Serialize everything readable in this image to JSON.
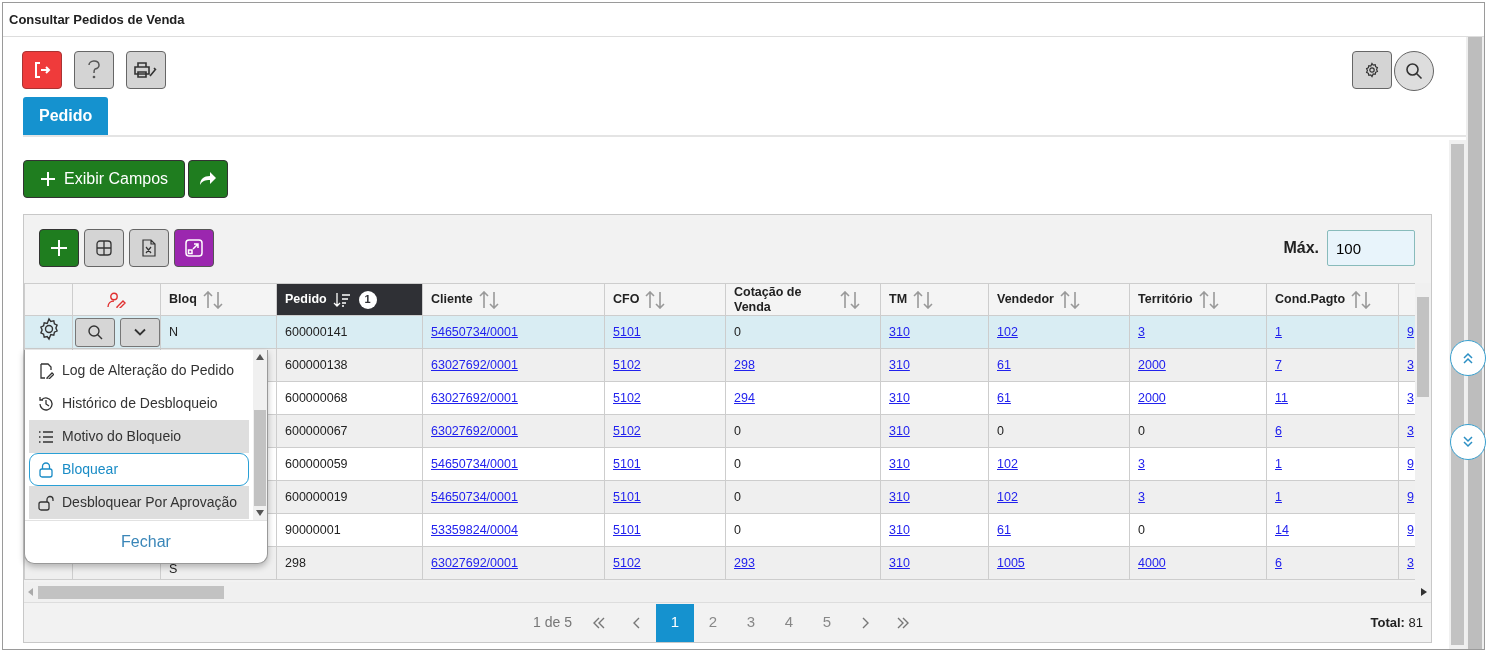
{
  "window": {
    "title": "Consultar Pedidos de Venda"
  },
  "tabs": [
    {
      "label": "Pedido",
      "selected": true
    }
  ],
  "show_fields_button": "Exibir Campos",
  "grid": {
    "max_label": "Máx.",
    "max_value": "100",
    "columns": [
      {
        "label": "Bloq",
        "sorted": false
      },
      {
        "label": "Pedido",
        "sorted": true,
        "sort_rank": "1"
      },
      {
        "label": "Cliente",
        "sorted": false
      },
      {
        "label": "CFO",
        "sorted": false
      },
      {
        "label": "Cotação de Venda",
        "sorted": false
      },
      {
        "label": "TM",
        "sorted": false
      },
      {
        "label": "Vendedor",
        "sorted": false
      },
      {
        "label": "Território",
        "sorted": false
      },
      {
        "label": "Cond.Pagto",
        "sorted": false
      }
    ],
    "rows": [
      {
        "selected": true,
        "cells": [
          {
            "text": "N",
            "link": false
          },
          {
            "text": "600000141",
            "link": false
          },
          {
            "text": "54650734/0001",
            "link": true
          },
          {
            "text": "5101",
            "link": true
          },
          {
            "text": "0",
            "link": false
          },
          {
            "text": "310",
            "link": true
          },
          {
            "text": "102",
            "link": true
          },
          {
            "text": "3",
            "link": true
          },
          {
            "text": "1",
            "link": true
          },
          {
            "text": "9",
            "link": true
          }
        ]
      },
      {
        "selected": false,
        "cells": [
          {
            "text": ""
          },
          {
            "text": "600000138",
            "link": false
          },
          {
            "text": "63027692/0001",
            "link": true
          },
          {
            "text": "5102",
            "link": true
          },
          {
            "text": "298",
            "link": true
          },
          {
            "text": "310",
            "link": true
          },
          {
            "text": "61",
            "link": true
          },
          {
            "text": "2000",
            "link": true
          },
          {
            "text": "7",
            "link": true
          },
          {
            "text": "3",
            "link": true
          }
        ]
      },
      {
        "selected": false,
        "cells": [
          {
            "text": ""
          },
          {
            "text": "600000068",
            "link": false
          },
          {
            "text": "63027692/0001",
            "link": true
          },
          {
            "text": "5102",
            "link": true
          },
          {
            "text": "294",
            "link": true
          },
          {
            "text": "310",
            "link": true
          },
          {
            "text": "61",
            "link": true
          },
          {
            "text": "2000",
            "link": true
          },
          {
            "text": "11",
            "link": true
          },
          {
            "text": "3",
            "link": true
          }
        ]
      },
      {
        "selected": false,
        "cells": [
          {
            "text": ""
          },
          {
            "text": "600000067",
            "link": false
          },
          {
            "text": "63027692/0001",
            "link": true
          },
          {
            "text": "5102",
            "link": true
          },
          {
            "text": "0",
            "link": false
          },
          {
            "text": "310",
            "link": true
          },
          {
            "text": "0",
            "link": false
          },
          {
            "text": "0",
            "link": false
          },
          {
            "text": "6",
            "link": true
          },
          {
            "text": "3",
            "link": true
          }
        ]
      },
      {
        "selected": false,
        "cells": [
          {
            "text": ""
          },
          {
            "text": "600000059",
            "link": false
          },
          {
            "text": "54650734/0001",
            "link": true
          },
          {
            "text": "5101",
            "link": true
          },
          {
            "text": "0",
            "link": false
          },
          {
            "text": "310",
            "link": true
          },
          {
            "text": "102",
            "link": true
          },
          {
            "text": "3",
            "link": true
          },
          {
            "text": "1",
            "link": true
          },
          {
            "text": "9",
            "link": true
          }
        ]
      },
      {
        "selected": false,
        "cells": [
          {
            "text": ""
          },
          {
            "text": "600000019",
            "link": false
          },
          {
            "text": "54650734/0001",
            "link": true
          },
          {
            "text": "5101",
            "link": true
          },
          {
            "text": "0",
            "link": false
          },
          {
            "text": "310",
            "link": true
          },
          {
            "text": "102",
            "link": true
          },
          {
            "text": "3",
            "link": true
          },
          {
            "text": "1",
            "link": true
          },
          {
            "text": "9",
            "link": true
          }
        ]
      },
      {
        "selected": false,
        "cells": [
          {
            "text": ""
          },
          {
            "text": "90000001",
            "link": false
          },
          {
            "text": "53359824/0004",
            "link": true
          },
          {
            "text": "5101",
            "link": true
          },
          {
            "text": "0",
            "link": false
          },
          {
            "text": "310",
            "link": true
          },
          {
            "text": "61",
            "link": true
          },
          {
            "text": "0",
            "link": false
          },
          {
            "text": "14",
            "link": true
          },
          {
            "text": "9",
            "link": true
          }
        ]
      },
      {
        "selected": false,
        "cells": [
          {
            "text": "S",
            "link": false
          },
          {
            "text": "298",
            "link": false
          },
          {
            "text": "63027692/0001",
            "link": true
          },
          {
            "text": "5102",
            "link": true
          },
          {
            "text": "293",
            "link": true
          },
          {
            "text": "310",
            "link": true
          },
          {
            "text": "1005",
            "link": true
          },
          {
            "text": "4000",
            "link": true
          },
          {
            "text": "6",
            "link": true
          },
          {
            "text": "3",
            "link": true
          }
        ]
      }
    ],
    "pagination": {
      "summary": "1 de 5",
      "pages": [
        {
          "label": "1",
          "selected": true
        },
        {
          "label": "2",
          "selected": false
        },
        {
          "label": "3",
          "selected": false
        },
        {
          "label": "4",
          "selected": false
        },
        {
          "label": "5",
          "selected": false
        }
      ],
      "total": "**Total:** 81"
    }
  },
  "row_menu": {
    "items": [
      {
        "label": "Log de Alteração do Pedido",
        "kind": "log",
        "highlighted": false,
        "selected": false
      },
      {
        "label": "Histórico de Desbloqueio",
        "kind": "history",
        "highlighted": false,
        "selected": false
      },
      {
        "label": "Motivo do Bloqueio",
        "kind": "list",
        "highlighted": true,
        "selected": false
      },
      {
        "label": "Bloquear",
        "kind": "lock",
        "highlighted": false,
        "selected": true
      },
      {
        "label": "Desbloquear Por Aprovação",
        "kind": "unlock",
        "highlighted": true,
        "selected": false
      }
    ],
    "close_label": "Fechar"
  }
}
